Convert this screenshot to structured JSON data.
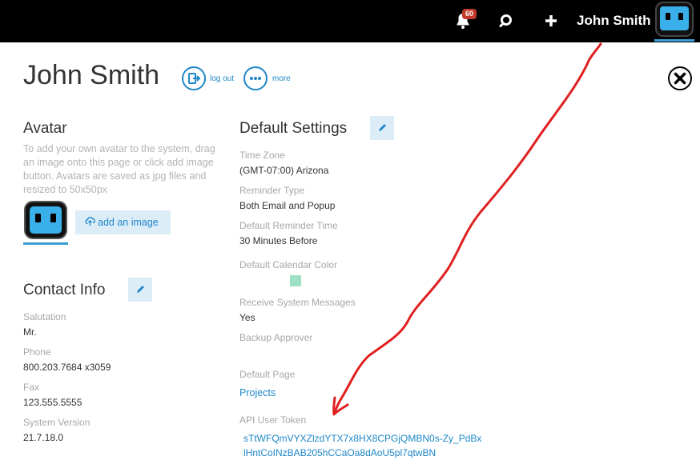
{
  "topbar": {
    "notification_count": "60",
    "user_name": "John Smith",
    "icons": {
      "bell": "bell-icon",
      "search": "search-icon",
      "plus": "plus-icon"
    }
  },
  "header": {
    "title": "John Smith",
    "logout_label": "log out",
    "more_label": "more"
  },
  "avatar_section": {
    "heading": "Avatar",
    "help_text": "To add your own avatar to the system, drag an image onto this page or click add image button. Avatars are saved as jpg files and resized to 50x50px",
    "add_image_label": "add an image"
  },
  "contact_info": {
    "heading": "Contact Info",
    "fields": [
      {
        "label": "Salutation",
        "value": "Mr."
      },
      {
        "label": "Phone",
        "value": "800.203.7684 x3059"
      },
      {
        "label": "Fax",
        "value": "123.555.5555"
      },
      {
        "label": "System Version",
        "value": "21.7.18.0"
      }
    ]
  },
  "default_settings": {
    "heading": "Default Settings",
    "time_zone_label": "Time Zone",
    "time_zone_value": "(GMT-07:00) Arizona",
    "reminder_type_label": "Reminder Type",
    "reminder_type_value": "Both Email and Popup",
    "reminder_time_label": "Default Reminder Time",
    "reminder_time_value": "30 Minutes Before",
    "calendar_color_label": "Default Calendar Color",
    "calendar_color": "#9ee0c4",
    "system_messages_label": "Receive System Messages",
    "system_messages_value": "Yes",
    "backup_approver_label": "Backup Approver",
    "default_page_label": "Default Page",
    "default_page_value": "Projects",
    "api_token_label": "API User Token",
    "api_token_value": "sTtWFQmVYXZlzdYTX7x8HX8CPGjQMBN0s-Zy_PdBxlHntCoINzBAB205hCCaOa8dAoU5pl7qtwBN"
  },
  "colors": {
    "accent": "#1e87c9",
    "topbar": "#000000",
    "badge": "#c0392b",
    "annotation": "#e02020"
  }
}
